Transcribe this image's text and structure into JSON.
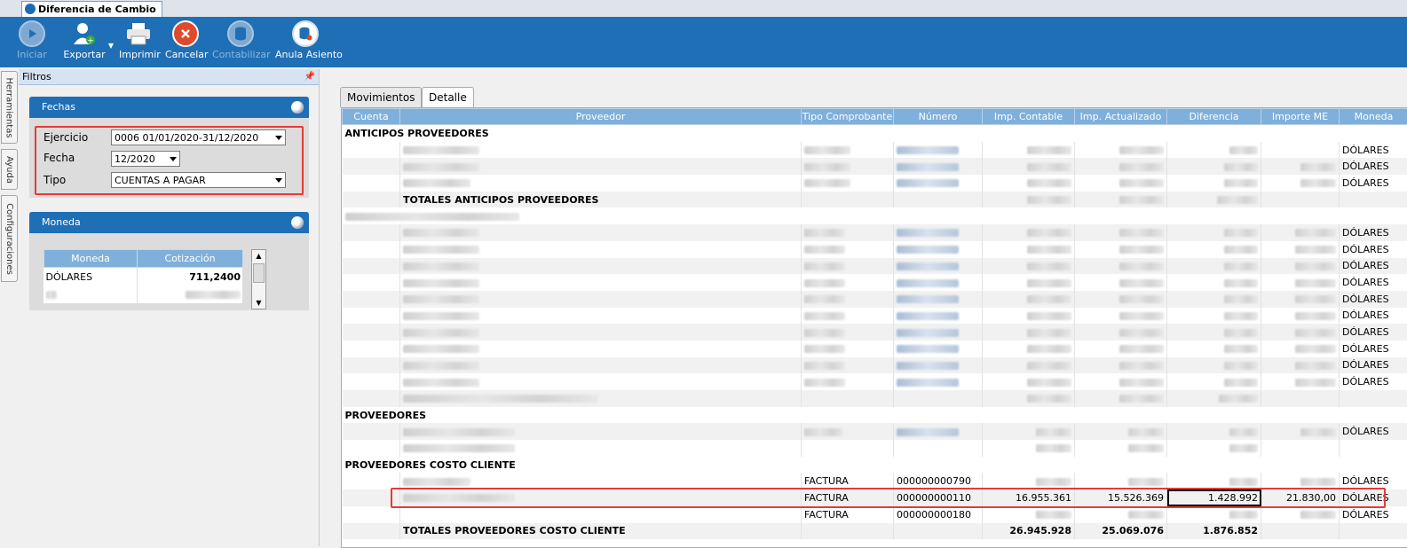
{
  "window": {
    "tab_title": "Diferencia de Cambio"
  },
  "toolbar": {
    "buttons": [
      {
        "label": "Iniciar",
        "icon": "play-icon",
        "enabled": false
      },
      {
        "label": "Exportar",
        "icon": "export-user-icon",
        "enabled": true
      },
      {
        "label": "Imprimir",
        "icon": "printer-icon",
        "enabled": true
      },
      {
        "label": "Cancelar",
        "icon": "cancel-icon",
        "enabled": true
      },
      {
        "label": "Contabilizar",
        "icon": "database-icon",
        "enabled": false
      },
      {
        "label": "Anula Asiento",
        "icon": "database-delete-icon",
        "enabled": true
      }
    ]
  },
  "side_tabs": [
    "Herramientas",
    "Ayuda",
    "Configuraciones"
  ],
  "filters": {
    "title": "Filtros",
    "fechas": {
      "title": "Fechas",
      "ejercicio_label": "Ejercicio",
      "ejercicio_value": "0006 01/01/2020-31/12/2020",
      "fecha_label": "Fecha",
      "fecha_value": "12/2020",
      "tipo_label": "Tipo",
      "tipo_value": "CUENTAS A PAGAR"
    },
    "moneda": {
      "title": "Moneda",
      "columns": [
        "Moneda",
        "Cotización"
      ],
      "rows": [
        [
          "DÓLARES",
          "711,2400"
        ]
      ]
    }
  },
  "main": {
    "tabs": [
      "Movimientos",
      "Detalle"
    ],
    "active_tab": "Detalle",
    "columns": [
      "Cuenta",
      "Proveedor",
      "Tipo Comprobante",
      "Número",
      "Imp. Contable",
      "Imp. Actualizado",
      "Diferencia",
      "Importe ME",
      "Moneda"
    ],
    "groups": {
      "anticipos": "ANTICIPOS PROVEEDORES",
      "anticipos_total": "TOTALES ANTICIPOS PROVEEDORES",
      "proveedores": "PROVEEDORES",
      "costo_cliente": "PROVEEDORES COSTO CLIENTE",
      "costo_cliente_total": "TOTALES PROVEEDORES COSTO CLIENTE"
    },
    "currency": "DÓLARES",
    "costo_cliente_rows": [
      {
        "tipo": "FACTURA",
        "numero": "000000000790",
        "imp_contable": "",
        "imp_actualizado": "",
        "diferencia": "",
        "importe_me": "",
        "moneda": "DÓLARES"
      },
      {
        "tipo": "FACTURA",
        "numero": "000000000110",
        "imp_contable": "16.955.361",
        "imp_actualizado": "15.526.369",
        "diferencia": "1.428.992",
        "importe_me": "21.830,00",
        "moneda": "DÓLARES"
      },
      {
        "tipo": "FACTURA",
        "numero": "000000000180",
        "imp_contable": "",
        "imp_actualizado": "",
        "diferencia": "",
        "importe_me": "",
        "moneda": "DÓLARES"
      }
    ],
    "costo_cliente_totals": {
      "imp_contable": "26.945.928",
      "imp_actualizado": "25.069.076",
      "diferencia": "1.876.852"
    }
  }
}
